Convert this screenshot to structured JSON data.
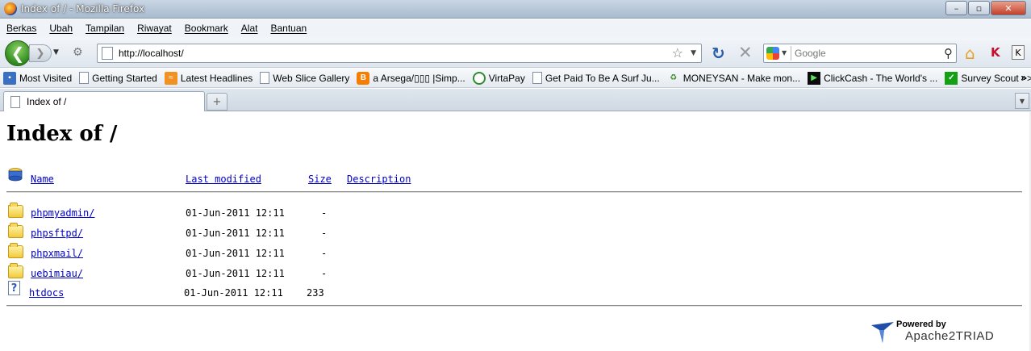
{
  "window": {
    "title": "Index of / - Mozilla Firefox",
    "minimize": "–",
    "maximize": "▫",
    "close": "✕"
  },
  "menu": [
    "Berkas",
    "Ubah",
    "Tampilan",
    "Riwayat",
    "Bookmark",
    "Alat",
    "Bantuan"
  ],
  "nav": {
    "url": "http://localhost/",
    "search_placeholder": "Google"
  },
  "bookmarks": [
    {
      "label": "Most Visited",
      "icon": "most-visited-icon"
    },
    {
      "label": "Getting Started",
      "icon": "page-icon"
    },
    {
      "label": "Latest Headlines",
      "icon": "rss-icon"
    },
    {
      "label": "Web Slice Gallery",
      "icon": "page-icon"
    },
    {
      "label": "a Arsega/▯▯▯ |Simp...",
      "icon": "blogger-icon"
    },
    {
      "label": "VirtaPay",
      "icon": "virtapay-icon"
    },
    {
      "label": "Get Paid To Be A Surf Ju...",
      "icon": "page-icon"
    },
    {
      "label": "MONEYSAN - Make mon...",
      "icon": "recycle-icon"
    },
    {
      "label": "ClickCash - The World's ...",
      "icon": "clickcash-icon"
    },
    {
      "label": "Survey Scout >> Where ...",
      "icon": "checkmark-icon"
    }
  ],
  "bookmarks_more": "»",
  "tab": {
    "title": "Index of /",
    "new_tab": "+"
  },
  "page": {
    "heading": "Index of /",
    "columns": {
      "name": "Name",
      "last_modified": "Last modified",
      "size": "Size",
      "description": "Description"
    },
    "rows": [
      {
        "name": "phpmyadmin/",
        "modified": "01-Jun-2011 12:11",
        "size": "-",
        "type": "folder"
      },
      {
        "name": "phpsftpd/",
        "modified": "01-Jun-2011 12:11",
        "size": "-",
        "type": "folder"
      },
      {
        "name": "phpxmail/",
        "modified": "01-Jun-2011 12:11",
        "size": "-",
        "type": "folder"
      },
      {
        "name": "uebimiau/",
        "modified": "01-Jun-2011 12:11",
        "size": "-",
        "type": "folder"
      },
      {
        "name": "htdocs",
        "modified": "01-Jun-2011 12:11",
        "size": "233",
        "type": "unknown"
      }
    ],
    "powered_by": "Powered by",
    "brand": "Apache2TRIAD"
  }
}
